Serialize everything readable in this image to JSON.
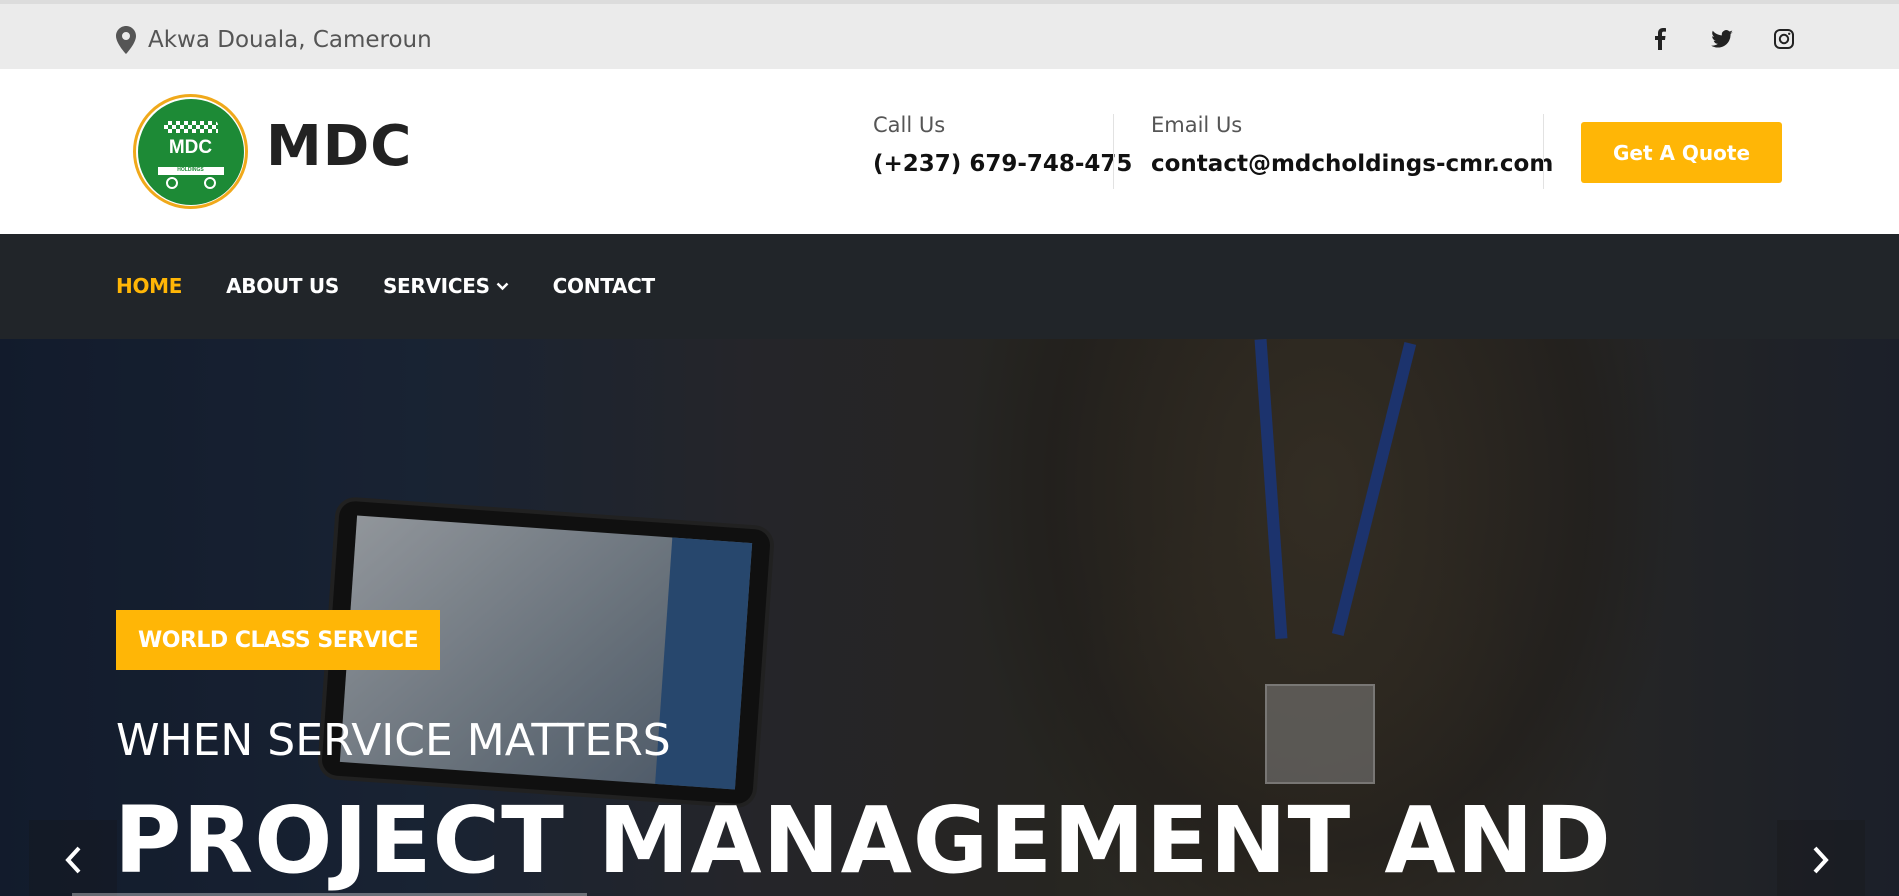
{
  "topbar": {
    "location": "Akwa Douala, Cameroun",
    "social": [
      "facebook-icon",
      "twitter-icon",
      "instagram-icon"
    ]
  },
  "header": {
    "brand": "MDC",
    "logo_text": "MDC",
    "logo_subtext": "HOLDINGS",
    "call_label": "Call Us",
    "call_value": "(+237) 679-748-475",
    "email_label": "Email Us",
    "email_value": "contact@mdcholdings-cmr.com",
    "quote_button": "Get A Quote"
  },
  "nav": {
    "items": [
      {
        "label": "HOME",
        "active": true
      },
      {
        "label": "ABOUT US",
        "active": false
      },
      {
        "label": "SERVICES",
        "active": false,
        "dropdown": true
      },
      {
        "label": "CONTACT",
        "active": false
      }
    ]
  },
  "hero": {
    "tag": "WORLD CLASS SERVICE",
    "subtitle": "WHEN SERVICE MATTERS",
    "headline": "PROJECT MANAGEMENT AND"
  },
  "colors": {
    "accent": "#ffb606",
    "nav_bg": "#212529",
    "logo_green": "#1d8a36"
  }
}
